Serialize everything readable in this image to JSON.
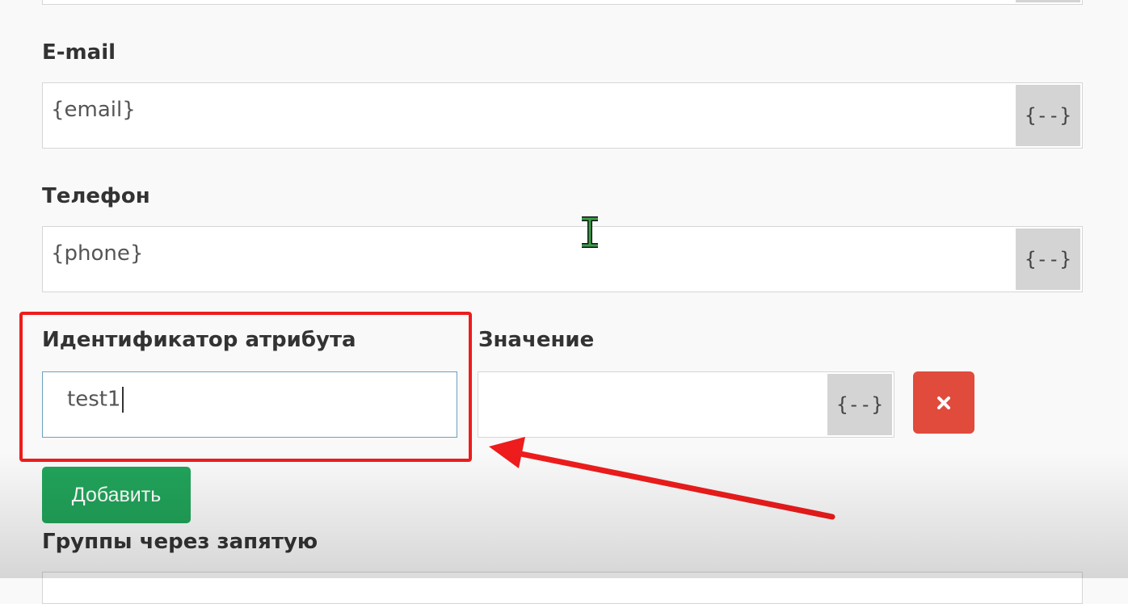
{
  "form": {
    "email": {
      "label": "E-mail",
      "value": "{email}",
      "addon": "{--}"
    },
    "phone": {
      "label": "Телефон",
      "value": "{phone}",
      "addon": "{--}"
    },
    "attribute": {
      "id_label": "Идентификатор атрибута",
      "id_value": "test1",
      "value_label": "Значение",
      "value_value": "",
      "value_addon": "{--}"
    },
    "add_button": "Добавить",
    "groups_label": "Группы через запятую"
  },
  "colors": {
    "highlight": "#ee1c1c",
    "add_button": "#21a35a",
    "delete_button": "#e04b3c",
    "addon_bg": "#d4d4d4"
  },
  "icons": {
    "delete": "close-icon",
    "cursor": "text-cursor-icon",
    "annotation_arrow": "arrow-icon"
  }
}
